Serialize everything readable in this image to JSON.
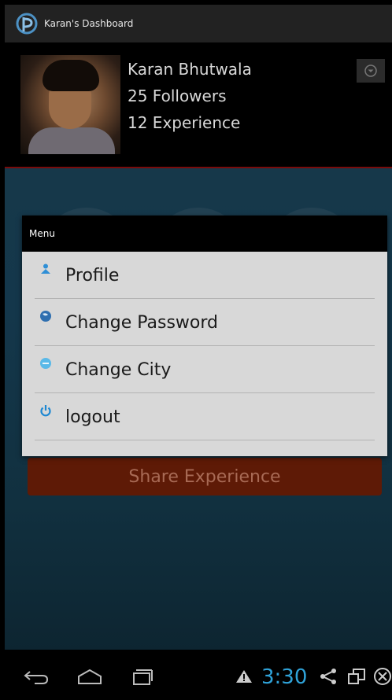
{
  "app": {
    "title": "Karan's Dashboard"
  },
  "profile": {
    "name": "Karan Bhutwala",
    "followers": "25 Followers",
    "experience": "12 Experience"
  },
  "menu": {
    "title": "Menu",
    "items": [
      {
        "label": "Profile",
        "icon": "person-icon",
        "icon_color": "#2f8fd6"
      },
      {
        "label": "Change Password",
        "icon": "globe-icon",
        "icon_color": "#2f6fb0"
      },
      {
        "label": "Change City",
        "icon": "city-icon",
        "icon_color": "#5ab9e8"
      },
      {
        "label": "logout",
        "icon": "power-icon",
        "icon_color": "#1e88d2"
      }
    ]
  },
  "main": {
    "share_label": "Share Experience"
  },
  "status": {
    "time": "3:30"
  },
  "colors": {
    "accent_red": "#7a0b0b",
    "share_button": "#5e1a06",
    "clock_blue": "#2fa2d8"
  }
}
